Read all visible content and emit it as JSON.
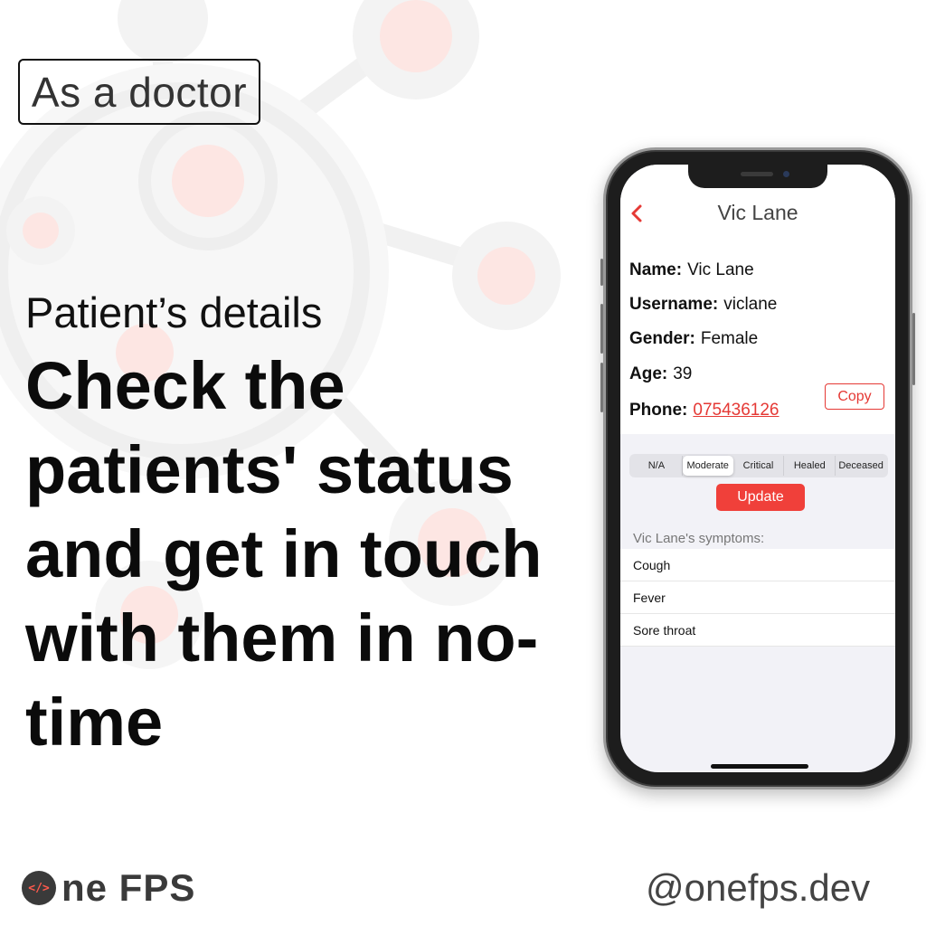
{
  "promo": {
    "tag": "As a doctor",
    "subtitle": "Patient’s details",
    "headline": "Check the patients' status and get in touch with them in no-time",
    "brand_mark": "</>",
    "brand_text": "ne FPS",
    "handle": "@onefps.dev"
  },
  "app": {
    "title": "Vic Lane",
    "fields": {
      "name_label": "Name:",
      "name_value": "Vic Lane",
      "username_label": "Username:",
      "username_value": "viclane",
      "gender_label": "Gender:",
      "gender_value": "Female",
      "age_label": "Age:",
      "age_value": "39",
      "phone_label": "Phone:",
      "phone_value": "075436126"
    },
    "copy_label": "Copy",
    "status_options": [
      "N/A",
      "Moderate",
      "Critical",
      "Healed",
      "Deceased"
    ],
    "status_selected": "Moderate",
    "update_label": "Update",
    "symptoms_header": "Vic Lane's symptoms:",
    "symptoms": [
      "Cough",
      "Fever",
      "Sore throat"
    ]
  },
  "colors": {
    "accent": "#e53935",
    "update_button": "#f0403a",
    "decoration": "#f0f0f0",
    "decoration_highlight": "#fde6e3"
  },
  "icons": {
    "back": "chevron-left-icon",
    "brand": "code-brackets-icon"
  }
}
